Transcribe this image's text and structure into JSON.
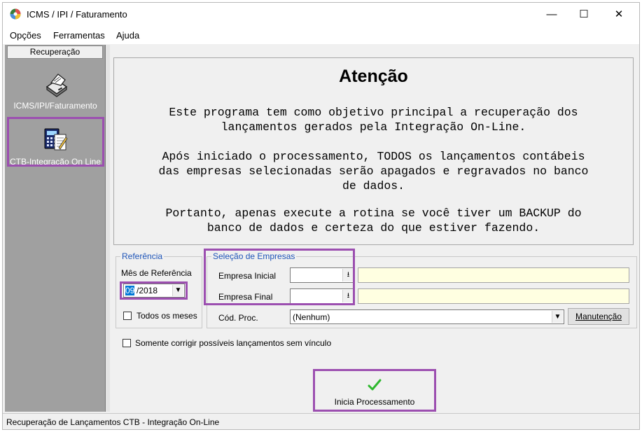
{
  "window": {
    "title": "ICMS / IPI / Faturamento",
    "minimize": "—",
    "maximize": "☐",
    "close": "✕"
  },
  "menu": [
    "Opções",
    "Ferramentas",
    "Ajuda"
  ],
  "sidebar": {
    "header": "Recuperação",
    "items": [
      {
        "label": "ICMS/IPI/Faturamento",
        "icon": "printer-icon"
      },
      {
        "label": "CTB-Integração On Line",
        "icon": "calculator-document-icon"
      }
    ]
  },
  "attention": {
    "title": "Atenção",
    "lines": [
      "Este programa tem como objetivo principal a recuperação dos",
      "lançamentos gerados pela Integração On-Line.",
      "Após iniciado o processamento, TODOS os lançamentos contábeis",
      "das empresas selecionadas serão apagados e regravados no banco",
      "de dados.",
      "Portanto, apenas execute a rotina se você tiver um BACKUP do",
      "banco de dados e certeza do que estiver fazendo."
    ]
  },
  "referencia": {
    "group_label": "Referência",
    "mes_label": "Mês de Referência",
    "mes_selected": "09",
    "mes_rest": "/2018",
    "todos_label": "Todos os meses",
    "todos_checked": false
  },
  "selecao": {
    "group_label": "Seleção de Empresas",
    "inicial_label": "Empresa Inicial",
    "final_label": "Empresa Final",
    "cod_proc_label": "Cód. Proc.",
    "cod_proc_value": "(Nenhum)",
    "manutencao_label": "Manutenção"
  },
  "somente_label": "Somente corrigir possíveis lançamentos sem vínculo",
  "somente_checked": false,
  "inicia_label": "Inicia Processamento",
  "status": "Recuperação de Lançamentos CTB - Integração On-Line",
  "colors": {
    "highlight": "#9c4fb0",
    "group_label": "#1f55b8",
    "check_green": "#2eb82e",
    "sidebar_bg": "#a0a0a0"
  }
}
